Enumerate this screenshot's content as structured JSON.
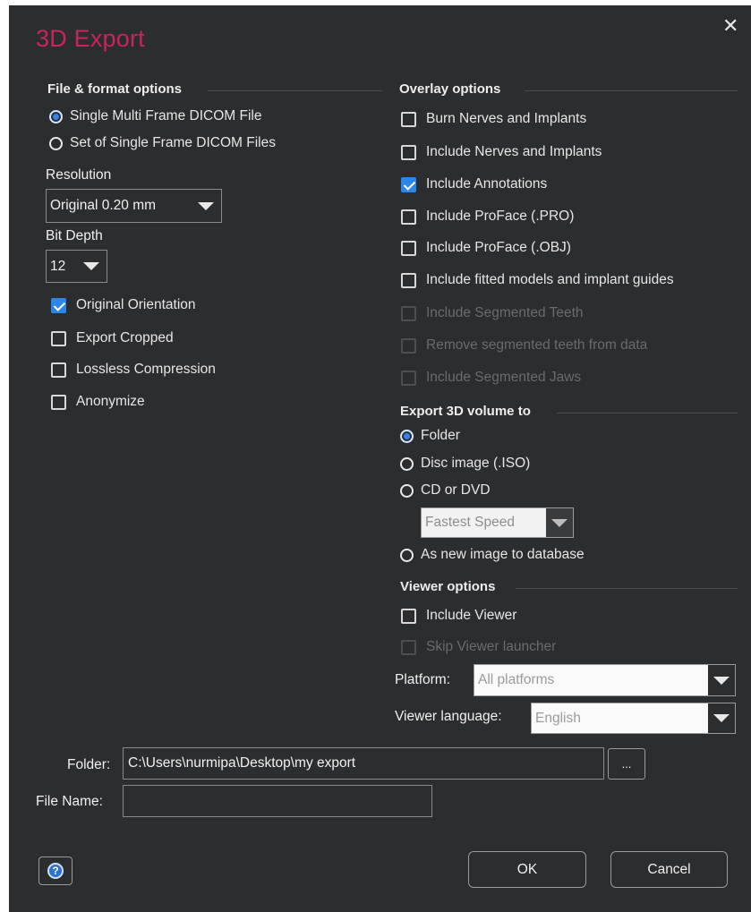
{
  "dialog": {
    "title": "3D Export",
    "close_glyph": "✕"
  },
  "file_format": {
    "heading": "File & format options",
    "options": [
      {
        "label": "Single Multi Frame DICOM File",
        "checked": true
      },
      {
        "label": "Set of Single Frame DICOM Files",
        "checked": false
      }
    ],
    "resolution_label": "Resolution",
    "resolution_value": "Original 0.20 mm",
    "bit_depth_label": "Bit Depth",
    "bit_depth_value": "12",
    "checkboxes": [
      {
        "label": "Original Orientation",
        "checked": true
      },
      {
        "label": "Export Cropped",
        "checked": false
      },
      {
        "label": "Lossless Compression",
        "checked": false
      },
      {
        "label": "Anonymize",
        "checked": false
      }
    ]
  },
  "overlay": {
    "heading": "Overlay options",
    "items": [
      {
        "label": "Burn Nerves and Implants",
        "checked": false,
        "enabled": true
      },
      {
        "label": "Include Nerves and Implants",
        "checked": false,
        "enabled": true
      },
      {
        "label": "Include Annotations",
        "checked": true,
        "enabled": true
      },
      {
        "label": "Include ProFace (.PRO)",
        "checked": false,
        "enabled": true
      },
      {
        "label": "Include ProFace (.OBJ)",
        "checked": false,
        "enabled": true
      },
      {
        "label": "Include fitted models and implant guides",
        "checked": false,
        "enabled": true
      },
      {
        "label": "Include Segmented Teeth",
        "checked": false,
        "enabled": false
      },
      {
        "label": "Remove segmented teeth from data",
        "checked": false,
        "enabled": false
      },
      {
        "label": "Include Segmented Jaws",
        "checked": false,
        "enabled": false
      }
    ]
  },
  "export_to": {
    "heading": "Export 3D volume to",
    "options": [
      {
        "label": "Folder",
        "checked": true
      },
      {
        "label": "Disc image (.ISO)",
        "checked": false
      },
      {
        "label": "CD or DVD",
        "checked": false
      }
    ],
    "speed_value": "Fastest Speed",
    "database_option": {
      "label": "As new image to database",
      "checked": false
    }
  },
  "viewer": {
    "heading": "Viewer options",
    "include_viewer": {
      "label": "Include Viewer",
      "checked": false,
      "enabled": true
    },
    "skip_launcher": {
      "label": "Skip Viewer launcher",
      "checked": false,
      "enabled": false
    },
    "platform_label": "Platform:",
    "platform_value": "All platforms",
    "language_label": "Viewer language:",
    "language_value": "English"
  },
  "folder": {
    "label": "Folder:",
    "value": "C:\\Users\\nurmipa\\Desktop\\my export",
    "browse_label": "..."
  },
  "filename": {
    "label": "File Name:",
    "value": ""
  },
  "buttons": {
    "help_glyph": "?",
    "ok": "OK",
    "cancel": "Cancel"
  },
  "colors": {
    "accent_title": "#c8245e",
    "check_blue": "#2b86e8",
    "background": "#2c2d2f"
  }
}
